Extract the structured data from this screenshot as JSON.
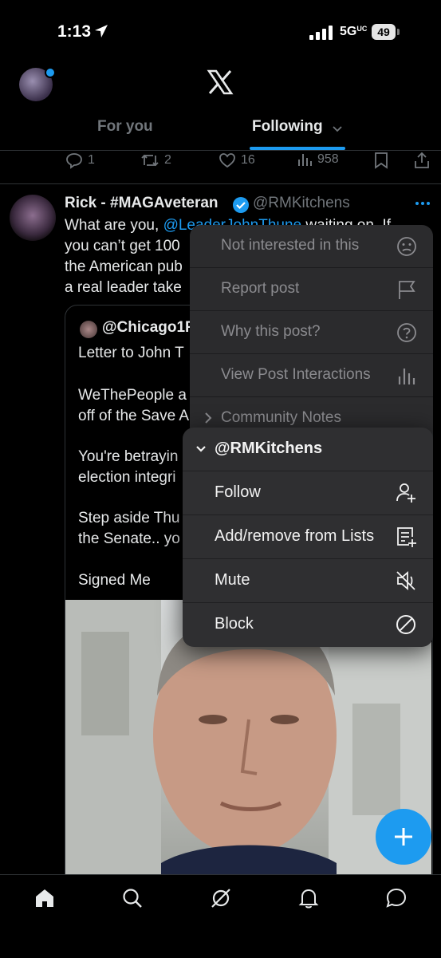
{
  "status_bar": {
    "time": "1:13",
    "network": "5G",
    "network_sub": "UC",
    "battery": "49"
  },
  "header": {
    "tabs": [
      {
        "label": "For you"
      },
      {
        "label": "Following"
      }
    ]
  },
  "prev_post_actions": {
    "replies": "1",
    "reposts": "2",
    "likes": "16",
    "views": "958"
  },
  "post": {
    "author_name": "Rick - #MAGAveteran",
    "author_handle": "@RMKitchens",
    "text_line1_pre": "What are you, ",
    "text_line1_mention": "@LeaderJohnThune",
    "text_line1_post": " waiting on. If",
    "text_line2": "you can’t get 100",
    "text_line3": "the American pub",
    "text_line4": "a real leader take",
    "quote": {
      "handle": "@Chicago1F",
      "line1": "Letter to John T",
      "line2": "WeThePeople a",
      "line3": "off of the Save A",
      "line4": "You're betrayin",
      "line5": "election integri",
      "line6": "Step aside Thu",
      "line7": "the Senate.. yo",
      "line8": "Signed Me"
    }
  },
  "menu": {
    "items": [
      {
        "label": "Not interested in this",
        "icon": "frown-face-icon"
      },
      {
        "label": "Report post",
        "icon": "flag-icon"
      },
      {
        "label": "Why this post?",
        "icon": "question-circle-icon"
      },
      {
        "label": "View Post Interactions",
        "icon": "bar-chart-icon"
      },
      {
        "label": "Community Notes",
        "icon": "chevron-right-icon"
      }
    ]
  },
  "submenu": {
    "header": "@RMKitchens",
    "items": [
      {
        "label": "Follow",
        "icon": "person-add-icon"
      },
      {
        "label": "Add/remove from Lists",
        "icon": "list-add-icon"
      },
      {
        "label": "Mute",
        "icon": "speaker-mute-icon"
      },
      {
        "label": "Block",
        "icon": "block-icon"
      }
    ]
  },
  "bottom_nav": {
    "items": [
      "home-icon",
      "search-icon",
      "grok-icon",
      "bell-icon",
      "messages-icon"
    ]
  },
  "colors": {
    "accent": "#1d9bf0",
    "background": "#000000",
    "menu": "#2b2b2d"
  }
}
